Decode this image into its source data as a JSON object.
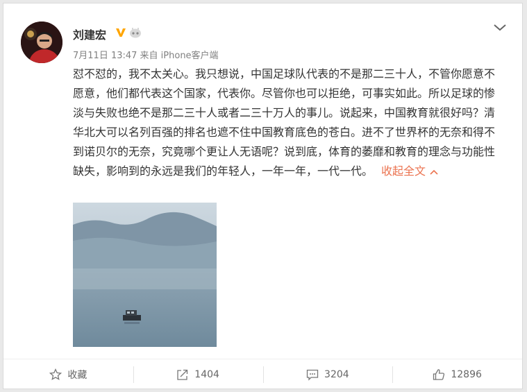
{
  "post": {
    "username": "刘建宏",
    "meta": "7月11日 13:47 来自 iPhone客户端",
    "text": "怼不怼的，我不太关心。我只想说，中国足球队代表的不是那二三十人，不管你愿意不愿意，他们都代表这个国家，代表你。尽管你也可以拒绝，可事实如此。所以足球的惨淡与失败也绝不是那二三十人或者二三十万人的事儿。说起来，中国教育就很好吗？清华北大可以名列百强的排名也遮不住中国教育底色的苍白。进不了世界杯的无奈和得不到诺贝尔的无奈，究竟哪个更让人无语呢？说到底，体育的萎靡和教育的理念与功能性缺失，影响到的永远是我们的年轻人，一年一年，一代一代。",
    "collapse_label": "收起全文"
  },
  "actions": {
    "favorite": "收藏",
    "repost": "1404",
    "comment": "3204",
    "like": "12896"
  },
  "colors": {
    "accent": "#eb7350",
    "verified": "#ffa500"
  },
  "icons": [
    "verified-icon",
    "member-badge-icon",
    "chevron-down-icon",
    "star-icon",
    "share-icon",
    "comment-icon",
    "thumbs-up-icon"
  ]
}
